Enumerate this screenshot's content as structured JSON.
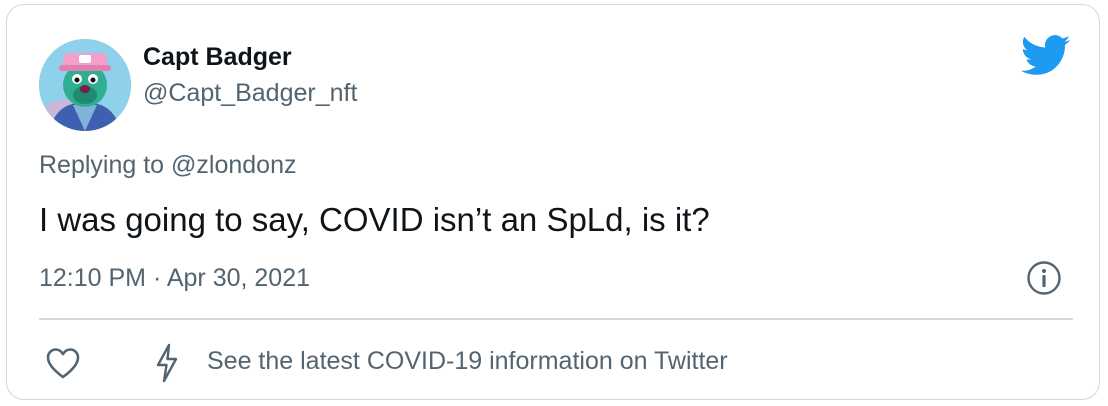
{
  "tweet": {
    "author_name": "Capt Badger",
    "author_handle": "@Capt_Badger_nft",
    "replying_prefix": "Replying to ",
    "replying_to": "@zlondonz",
    "text": "I was going to say, COVID isn’t an SpLd, is it?",
    "timestamp": "12:10 PM · Apr 30, 2021"
  },
  "footer": {
    "covid_link": "See the latest COVID-19 information on Twitter"
  },
  "icons": {
    "brand": "twitter-bird-icon",
    "info": "info-icon",
    "like": "heart-icon",
    "covid": "lightning-bolt-icon"
  },
  "colors": {
    "brand_blue": "#1d9bf0",
    "secondary_text": "#536471",
    "primary_text": "#0f1419",
    "border": "#cfd9de"
  }
}
